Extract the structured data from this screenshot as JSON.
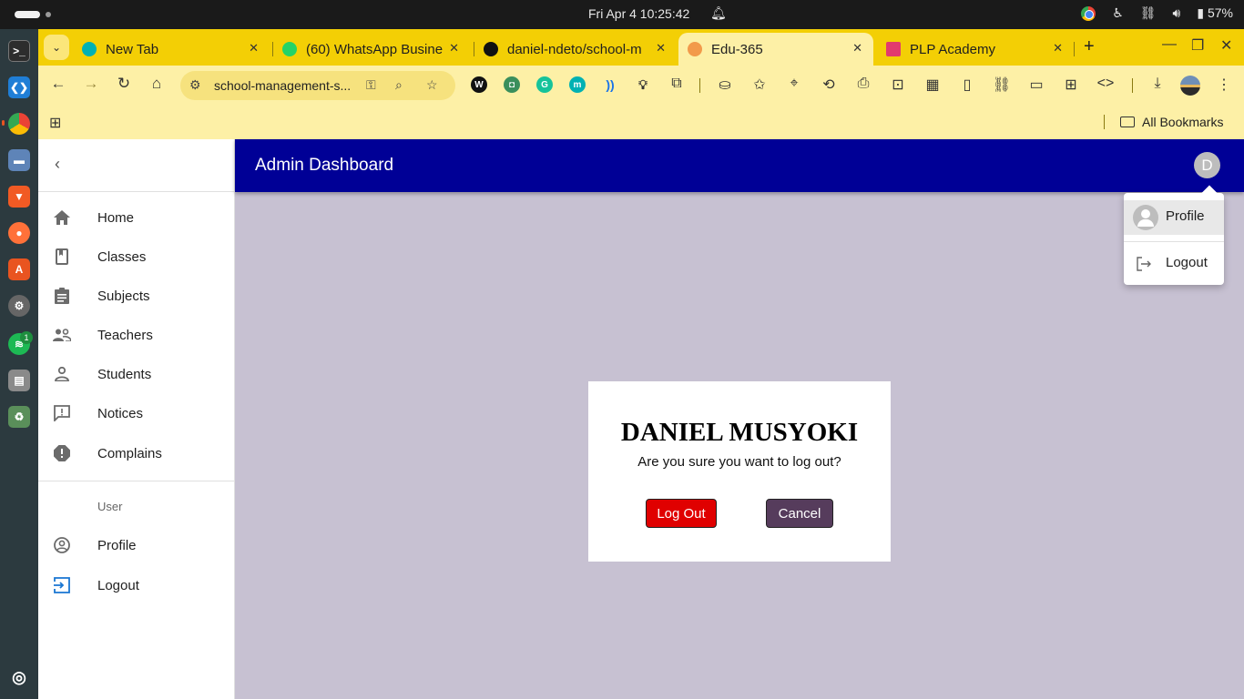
{
  "os": {
    "clock": "Fri Apr 4  10:25:42",
    "battery": "57%"
  },
  "browser": {
    "tabs": [
      {
        "title": "New Tab",
        "favicon_color": "#00b1b3",
        "active": false
      },
      {
        "title": "(60) WhatsApp Busine",
        "favicon_color": "#25d366",
        "active": false
      },
      {
        "title": "daniel-ndeto/school-m",
        "favicon_color": "#111111",
        "active": false
      },
      {
        "title": "Edu-365",
        "favicon_color": "#f29a4a",
        "active": true
      },
      {
        "title": "PLP Academy",
        "favicon_color": "#e23a6d",
        "active": false
      }
    ],
    "url": "school-management-s...",
    "bookmarks_label": "All Bookmarks"
  },
  "app": {
    "appbar_title": "Admin Dashboard",
    "avatar_initial": "D",
    "nav_items": [
      {
        "label": "Home",
        "icon": "home-icon"
      },
      {
        "label": "Classes",
        "icon": "class-icon"
      },
      {
        "label": "Subjects",
        "icon": "assignment-icon"
      },
      {
        "label": "Teachers",
        "icon": "supervisor-icon"
      },
      {
        "label": "Students",
        "icon": "person-outline-icon"
      },
      {
        "label": "Notices",
        "icon": "announcement-icon"
      },
      {
        "label": "Complains",
        "icon": "report-icon"
      }
    ],
    "user_section_label": "User",
    "user_items": [
      {
        "label": "Profile",
        "icon": "account-circle-icon"
      },
      {
        "label": "Logout",
        "icon": "exit-to-app-icon"
      }
    ],
    "account_menu": {
      "profile_label": "Profile",
      "logout_label": "Logout"
    },
    "dialog": {
      "name": "DANIEL MUSYOKI",
      "question": "Are you sure you want to log out?",
      "logout_button": "Log Out",
      "cancel_button": "Cancel"
    }
  },
  "colors": {
    "appbar": "#000096",
    "browser_theme": "#f3cf05",
    "backdrop": "#c7c1d2",
    "logout_button": "#e00000",
    "cancel_button": "#563c5c"
  }
}
